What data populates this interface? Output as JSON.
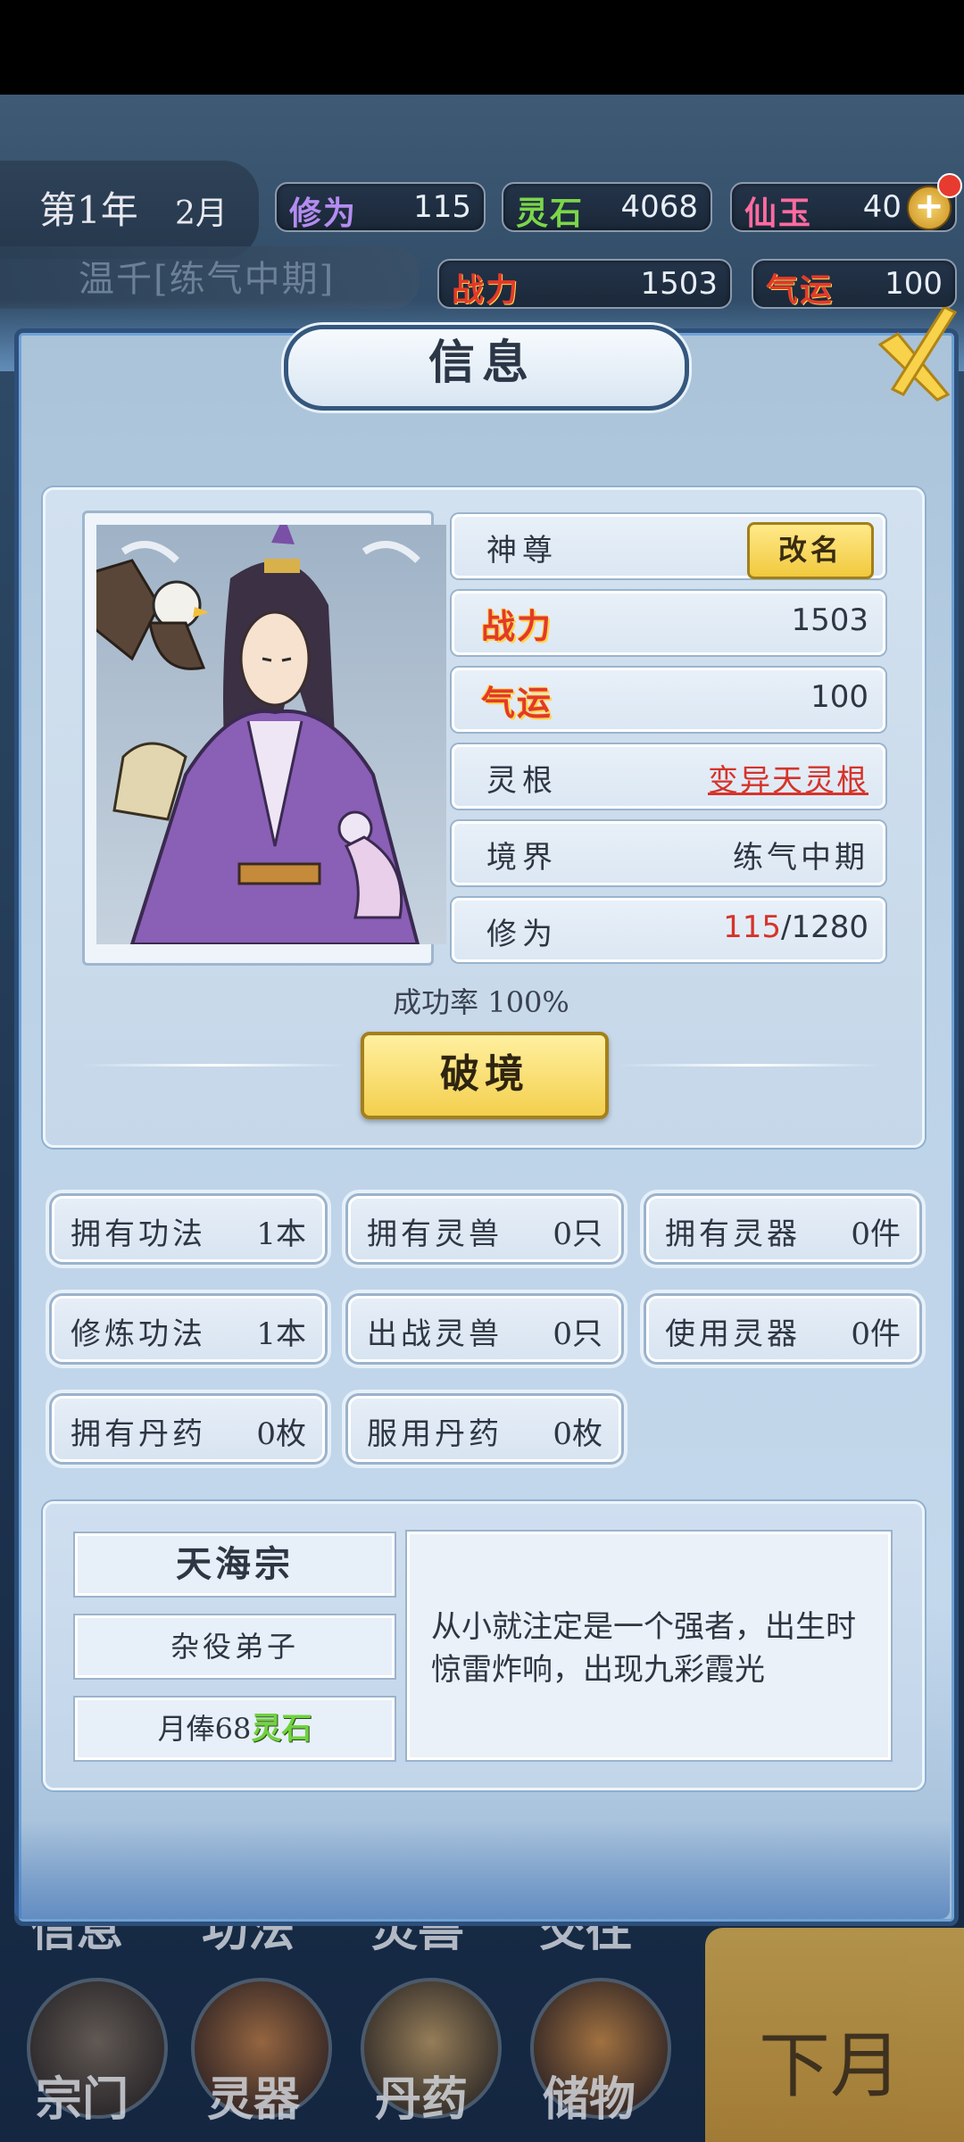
{
  "status": {
    "year": "第1年",
    "month": "2月",
    "name_realm": "温千[练气中期]",
    "xiuwei": {
      "label": "修为",
      "value": "115",
      "color": "#b48cf0"
    },
    "lingshi": {
      "label": "灵石",
      "value": "4068",
      "color": "#7bd64a"
    },
    "xianyu": {
      "label": "仙玉",
      "value": "40",
      "color": "#ff6ba0"
    },
    "zhanli": {
      "label": "战力",
      "value": "1503",
      "color": "#e23a2a"
    },
    "qiyun": {
      "label": "气运",
      "value": "100",
      "color": "#e23a2a"
    }
  },
  "panel": {
    "title": "信息"
  },
  "character": {
    "title_name": "神尊",
    "rename_label": "改名",
    "zhanli_label": "战力",
    "zhanli_value": "1503",
    "qiyun_label": "气运",
    "qiyun_value": "100",
    "linggen_label": "灵根",
    "linggen_value": "变异天灵根",
    "jingjie_label": "境界",
    "jingjie_value": "练气中期",
    "xiuwei_label": "修为",
    "xiuwei_current": "115",
    "xiuwei_max": "/1280",
    "success_rate": "成功率 100%",
    "break_label": "破境"
  },
  "counts": [
    {
      "label": "拥有功法",
      "value": "1本"
    },
    {
      "label": "拥有灵兽",
      "value": "0只"
    },
    {
      "label": "拥有灵器",
      "value": "0件"
    },
    {
      "label": "修炼功法",
      "value": "1本"
    },
    {
      "label": "出战灵兽",
      "value": "0只"
    },
    {
      "label": "使用灵器",
      "value": "0件"
    },
    {
      "label": "拥有丹药",
      "value": "0枚"
    },
    {
      "label": "服用丹药",
      "value": "0枚"
    }
  ],
  "sect": {
    "name": "天海宗",
    "rank": "杂役弟子",
    "salary_prefix": "月俸68",
    "salary_unit": "灵石",
    "description": "从小就注定是一个强者，出生时惊雷炸响，出现九彩霞光"
  },
  "nav": {
    "top_row": [
      "信息",
      "功法",
      "灵兽",
      "交往"
    ],
    "bottom_row": [
      "宗门",
      "灵器",
      "丹药",
      "储物"
    ],
    "next_month": "下月"
  }
}
